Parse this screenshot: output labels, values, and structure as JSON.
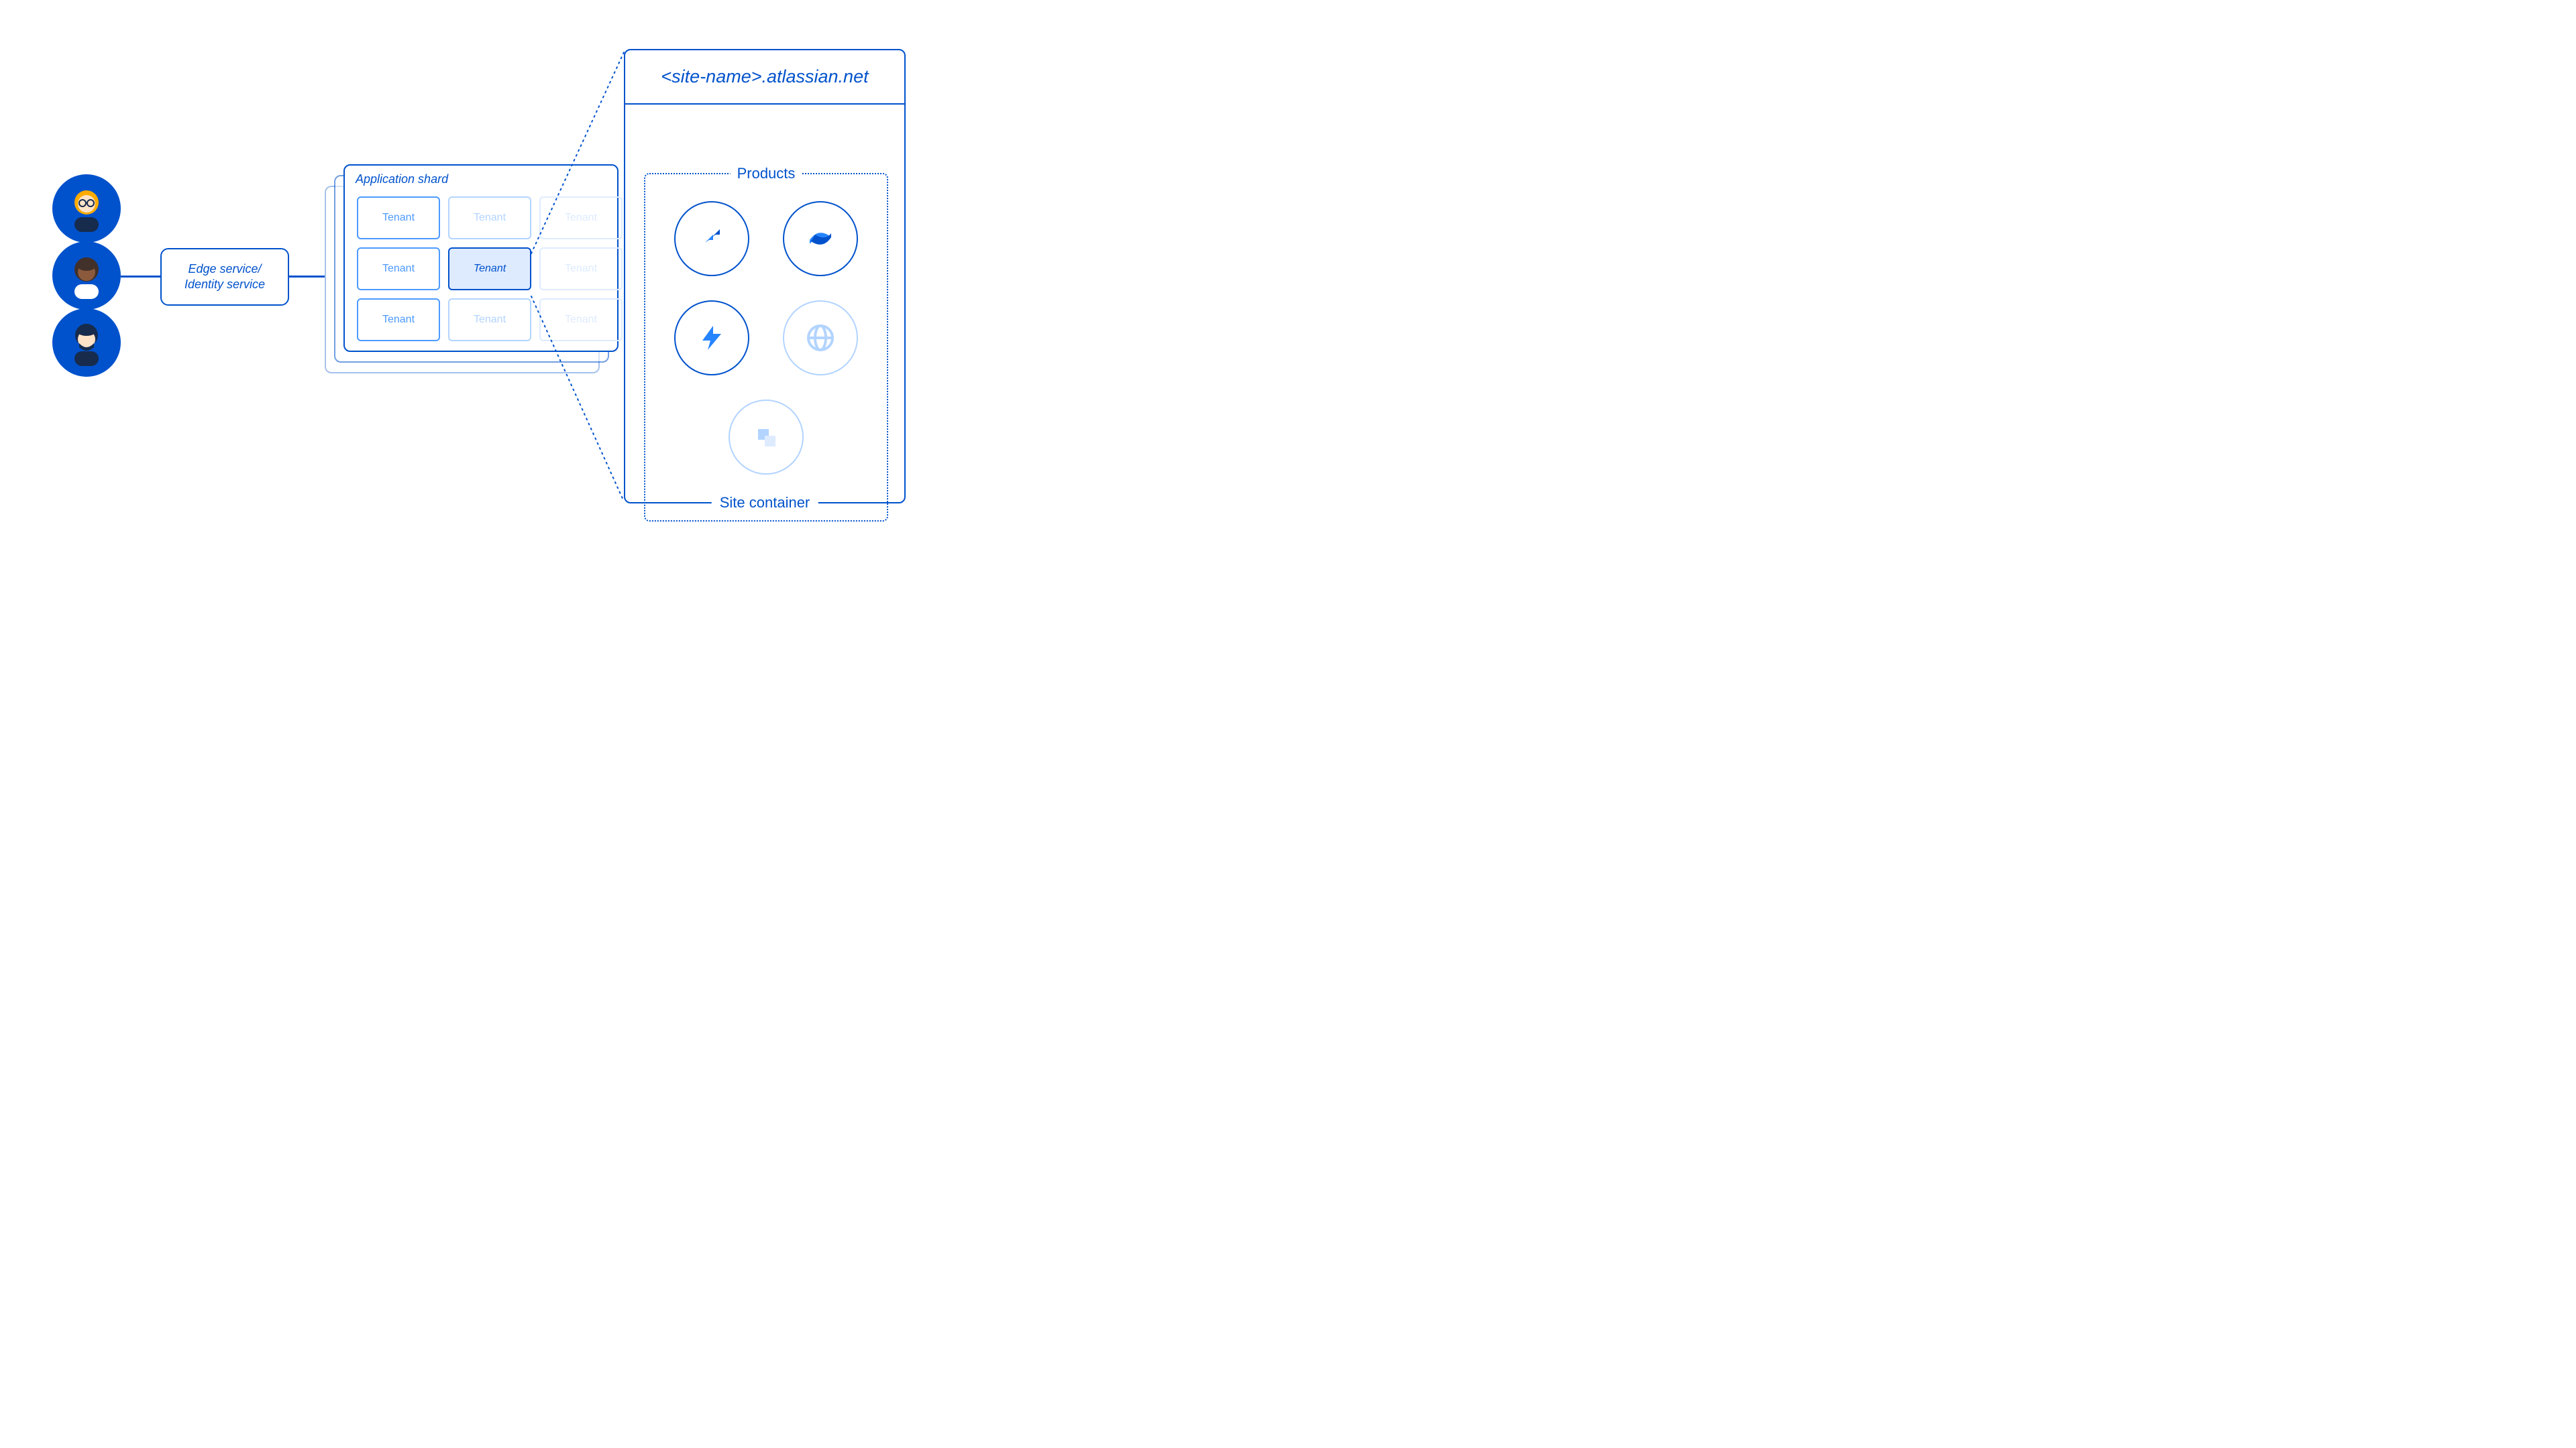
{
  "edge_service": {
    "label": "Edge service/\nIdentity service"
  },
  "shard": {
    "title": "Application shard",
    "tenants": [
      [
        "Tenant",
        "Tenant",
        "Tenant"
      ],
      [
        "Tenant",
        "Tenant",
        "Tenant"
      ],
      [
        "Tenant",
        "Tenant",
        "Tenant"
      ]
    ],
    "highlighted_tenant_text": "Tenant"
  },
  "site": {
    "url": "<site-name>.atlassian.net",
    "products_label": "Products",
    "container_label": "Site container",
    "products": [
      {
        "name": "jira-software-icon",
        "active": true
      },
      {
        "name": "confluence-icon",
        "active": true
      },
      {
        "name": "jira-service-management-icon",
        "active": true
      },
      {
        "name": "atlas-icon",
        "active": false
      },
      {
        "name": "compass-icon",
        "active": false
      }
    ]
  },
  "avatars": [
    {
      "name": "avatar-user-1"
    },
    {
      "name": "avatar-user-2"
    },
    {
      "name": "avatar-user-3"
    }
  ],
  "colors": {
    "primary": "#0052CC",
    "accent": "#2684FF",
    "light": "#B3D4FF",
    "bg_highlight": "#DEEBFF"
  }
}
